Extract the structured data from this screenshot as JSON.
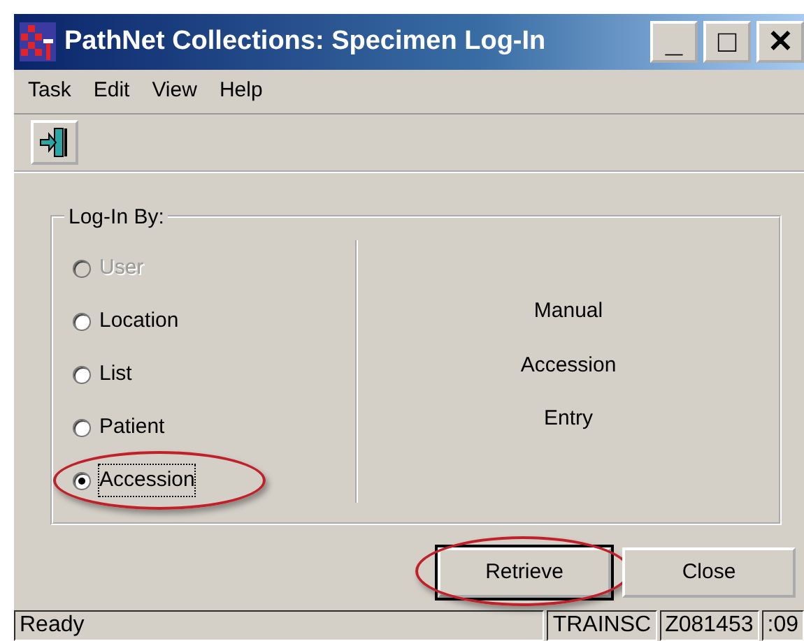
{
  "window": {
    "title": "PathNet Collections: Specimen Log-In",
    "controls": [
      "_",
      "□",
      "✕"
    ]
  },
  "menu": [
    "Task",
    "Edit",
    "View",
    "Help"
  ],
  "group": {
    "title": "Log-In By:",
    "options": [
      {
        "label": "User",
        "selected": false,
        "disabled": true,
        "highlighted": false
      },
      {
        "label": "Location",
        "selected": false,
        "disabled": false,
        "highlighted": false
      },
      {
        "label": "List",
        "selected": false,
        "disabled": false,
        "highlighted": false
      },
      {
        "label": "Patient",
        "selected": false,
        "disabled": false,
        "highlighted": false
      },
      {
        "label": "Accession",
        "selected": true,
        "disabled": false,
        "highlighted": true
      }
    ],
    "description": [
      "Manual",
      "Accession",
      "Entry"
    ]
  },
  "buttons": [
    {
      "label": "Retrieve",
      "highlighted": true
    },
    {
      "label": "Close",
      "highlighted": false
    }
  ],
  "status_bar": [
    "Ready",
    "TRAINSC",
    "Z081453",
    ":09"
  ]
}
